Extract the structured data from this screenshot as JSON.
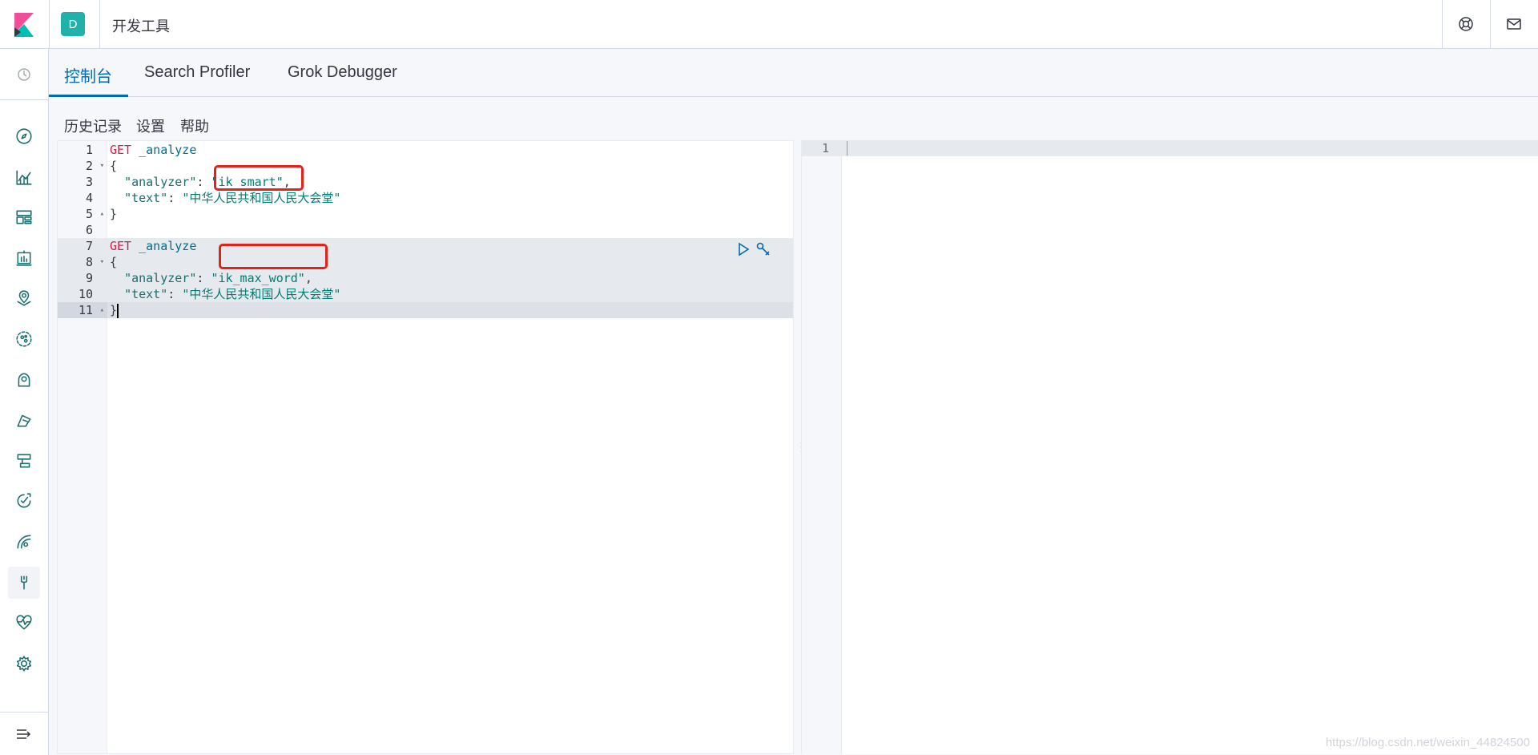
{
  "header": {
    "logo": "kibana-logo",
    "space_initial": "D",
    "app_title": "开发工具",
    "icons": [
      "help-icon",
      "mail-icon"
    ]
  },
  "sidebar": {
    "recent_icon": "clock-icon",
    "items": [
      {
        "icon": "compass-icon"
      },
      {
        "icon": "visualize-icon"
      },
      {
        "icon": "dashboard-icon"
      },
      {
        "icon": "canvas-icon"
      },
      {
        "icon": "maps-icon"
      },
      {
        "icon": "ml-icon"
      },
      {
        "icon": "infrastructure-icon"
      },
      {
        "icon": "logs-icon"
      },
      {
        "icon": "apm-icon"
      },
      {
        "icon": "uptime-icon"
      },
      {
        "icon": "siem-icon"
      },
      {
        "icon": "dev-tools-icon",
        "active": true
      },
      {
        "icon": "monitoring-icon"
      },
      {
        "icon": "management-icon"
      }
    ],
    "collapse_icon": "collapse-menu-icon"
  },
  "tabs": [
    {
      "label": "控制台",
      "selected": true
    },
    {
      "label": "Search Profiler",
      "selected": false
    },
    {
      "label": "Grok Debugger",
      "selected": false
    }
  ],
  "subnav": {
    "history": "历史记录",
    "settings": "设置",
    "help": "帮助"
  },
  "editor": {
    "lines": [
      {
        "n": "1",
        "fold": "",
        "tokens": [
          {
            "c": "kw",
            "t": "GET"
          },
          {
            "c": "punc",
            "t": " "
          },
          {
            "c": "url",
            "t": "_analyze"
          }
        ]
      },
      {
        "n": "2",
        "fold": "▾",
        "tokens": [
          {
            "c": "punc",
            "t": "{"
          }
        ]
      },
      {
        "n": "3",
        "fold": "",
        "tokens": [
          {
            "c": "punc",
            "t": "  "
          },
          {
            "c": "key",
            "t": "\"analyzer\""
          },
          {
            "c": "punc",
            "t": ": "
          },
          {
            "c": "str",
            "t": "\"ik_smart\""
          },
          {
            "c": "punc",
            "t": ","
          }
        ]
      },
      {
        "n": "4",
        "fold": "",
        "tokens": [
          {
            "c": "punc",
            "t": "  "
          },
          {
            "c": "key",
            "t": "\"text\""
          },
          {
            "c": "punc",
            "t": ": "
          },
          {
            "c": "str",
            "t": "\"中华人民共和国人民大会堂\""
          }
        ]
      },
      {
        "n": "5",
        "fold": "▴",
        "tokens": [
          {
            "c": "punc",
            "t": "}"
          }
        ]
      },
      {
        "n": "6",
        "fold": "",
        "tokens": []
      },
      {
        "n": "7",
        "fold": "",
        "tokens": [
          {
            "c": "kw",
            "t": "GET"
          },
          {
            "c": "punc",
            "t": " "
          },
          {
            "c": "url",
            "t": "_analyze"
          }
        ]
      },
      {
        "n": "8",
        "fold": "▾",
        "tokens": [
          {
            "c": "punc",
            "t": "{"
          }
        ]
      },
      {
        "n": "9",
        "fold": "",
        "tokens": [
          {
            "c": "punc",
            "t": "  "
          },
          {
            "c": "key",
            "t": "\"analyzer\""
          },
          {
            "c": "punc",
            "t": ": "
          },
          {
            "c": "str",
            "t": "\"ik_max_word\""
          },
          {
            "c": "punc",
            "t": ","
          }
        ]
      },
      {
        "n": "10",
        "fold": "",
        "tokens": [
          {
            "c": "punc",
            "t": "  "
          },
          {
            "c": "key",
            "t": "\"text\""
          },
          {
            "c": "punc",
            "t": ": "
          },
          {
            "c": "str",
            "t": "\"中华人民共和国人民大会堂\""
          }
        ]
      },
      {
        "n": "11",
        "fold": "▴",
        "tokens": [
          {
            "c": "punc",
            "t": "}"
          }
        ]
      }
    ],
    "action_icons": [
      "play-icon",
      "wrench-icon"
    ]
  },
  "output": {
    "lines": [
      "1"
    ]
  },
  "watermark": "https://blog.csdn.net/weixin_44824500",
  "colors": {
    "accent": "#006bb4",
    "highlight_box": "#e2231a",
    "space_badge": "#20b2aa"
  }
}
